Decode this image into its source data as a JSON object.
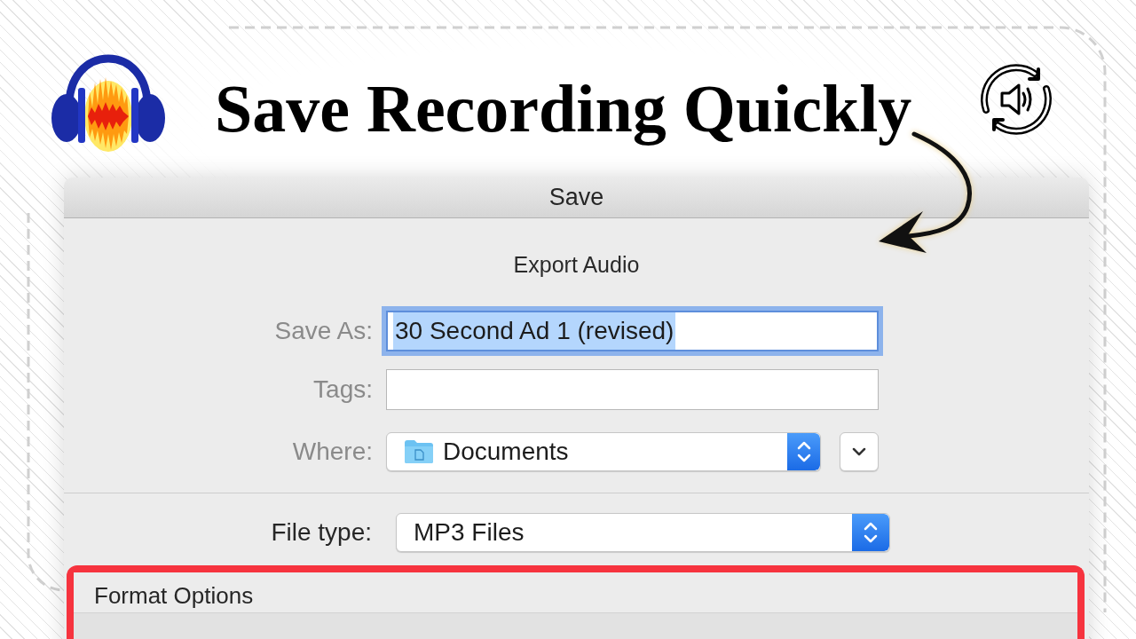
{
  "header": {
    "title": "Save Recording Quickly"
  },
  "dialog": {
    "title": "Save",
    "subtitle": "Export Audio",
    "fields": [
      {
        "kind": "text",
        "label": "Save As:",
        "value": "30 Second Ad 1 (revised)",
        "focused": true
      },
      {
        "kind": "text",
        "label": "Tags:",
        "focused": false
      },
      {
        "kind": "location",
        "label": "Where:",
        "value": "Documents"
      }
    ],
    "file_type": {
      "label": "File type:",
      "value": "MP3 Files"
    },
    "format_options": {
      "title": "Format Options",
      "highlighted": true
    }
  }
}
